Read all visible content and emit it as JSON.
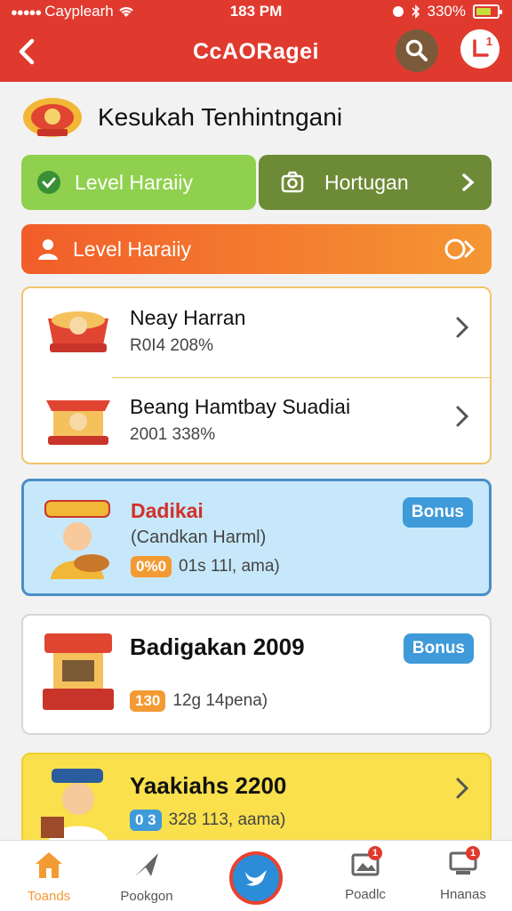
{
  "status_bar": {
    "carrier": "Cayplearh",
    "time": "183 PM",
    "battery": "330%"
  },
  "app_bar": {
    "title": "CcAORagei",
    "notif_count": "1"
  },
  "header": {
    "title": "Kesukah Tenhintngani"
  },
  "pills": {
    "level_label": "Level Haraiiy",
    "secondary_label": "Hortugan",
    "banner_label": "Level Haraiiy"
  },
  "list_group": [
    {
      "title": "Neay Harran",
      "subtitle": "R0I4 208%"
    },
    {
      "title": "Beang Hamtbay Suadiai",
      "subtitle": "2001 338%"
    }
  ],
  "promo_blue": {
    "title": "Dadikai",
    "subtitle": "(Candkan Harml)",
    "tag": "0%0",
    "detail": "01s 11l, ama)",
    "badge": "Bonus",
    "colors": {
      "title": "#d0322a",
      "badge": "#3e9ad9"
    }
  },
  "promo_white": {
    "title": "Badigakan 2009",
    "tag": "130",
    "detail": "12g 14pena)",
    "badge": "Bonus"
  },
  "promo_yellow": {
    "title": "Yaakiahs 2200",
    "tag": "0 3",
    "detail": "328 113, aama)"
  },
  "bottom_nav": [
    {
      "label": "Toands",
      "icon": "home-icon"
    },
    {
      "label": "Pookgon",
      "icon": "send-icon"
    },
    {
      "label": "",
      "icon": "bird-icon"
    },
    {
      "label": "Poadlc",
      "icon": "image-icon",
      "badge": "1"
    },
    {
      "label": "Hnanas",
      "icon": "monitor-icon",
      "badge": "1"
    }
  ]
}
